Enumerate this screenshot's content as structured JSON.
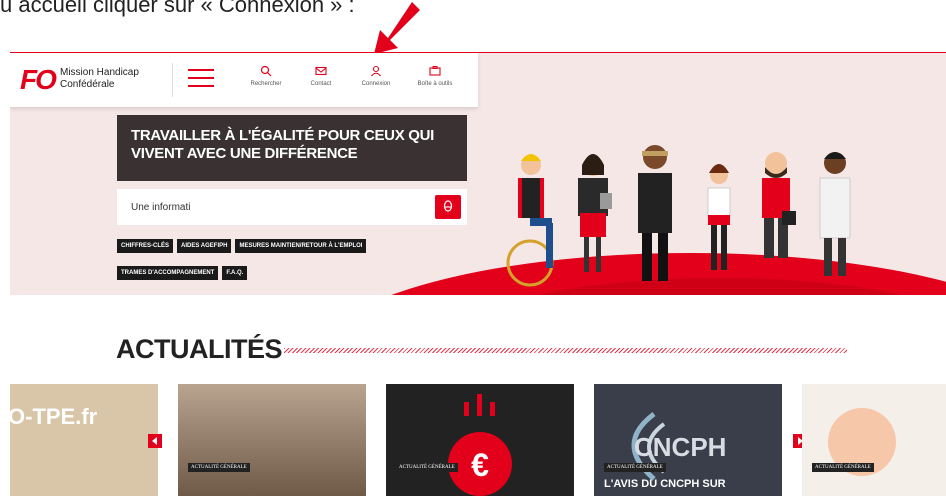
{
  "instruction": {
    "text": "u accueil cliquer sur « Connexion » :"
  },
  "header": {
    "logo": "FO",
    "brand_line1": "Mission Handicap",
    "brand_line2": "Confédérale",
    "nav": [
      {
        "label": "Rechercher",
        "icon": "search-icon"
      },
      {
        "label": "Contact",
        "icon": "mail-icon"
      },
      {
        "label": "Connexion",
        "icon": "user-icon"
      },
      {
        "label": "Boîte à outils",
        "icon": "toolbox-icon"
      }
    ]
  },
  "hero": {
    "title_line1": "TRAVAILLER À L'ÉGALITÉ POUR CEUX QUI",
    "title_line2": "VIVENT AVEC UNE DIFFÉRENCE",
    "search_value": "Une informati",
    "tags": [
      "CHIFFRES-CLÉS",
      "AIDES AGEFIPH",
      "MESURES MAINTIEN/RETOUR À L'EMPLOI",
      "TRAMES D'ACCOMPAGNEMENT",
      "F.A.Q."
    ]
  },
  "news": {
    "title": "ACTUALITÉS",
    "cards": [
      {
        "image_text": "O-TPE.fr",
        "badge": "",
        "headline": ""
      },
      {
        "image_text": "",
        "badge": "ACTUALITÉ GÉNÉRALE",
        "headline": ""
      },
      {
        "image_text": "",
        "badge": "ACTUALITÉ GÉNÉRALE",
        "headline": ""
      },
      {
        "image_text": "CNCPH",
        "badge": "ACTUALITÉ GÉNÉRALE",
        "headline": "L'AVIS DU CNCPH SUR"
      },
      {
        "image_text": "",
        "badge": "ACTUALITÉ GÉNÉRALE",
        "headline": ""
      }
    ]
  },
  "colors": {
    "brand_red": "#e2001a",
    "dark": "#3a3232"
  }
}
